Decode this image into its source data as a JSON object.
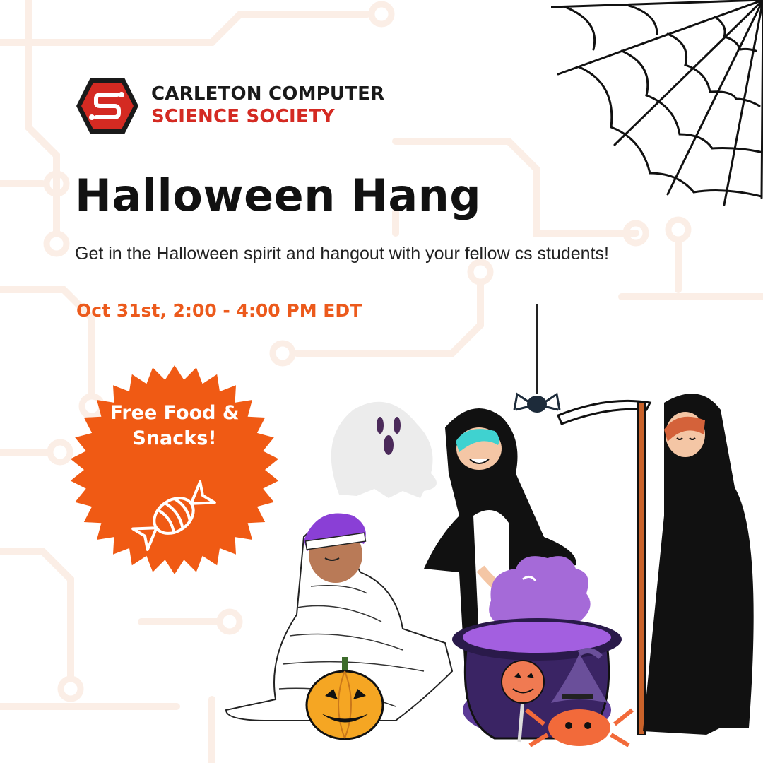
{
  "logo": {
    "line1": "CARLETON COMPUTER",
    "line2": "SCIENCE SOCIETY",
    "icon": "hexagon-circuit-s-logo"
  },
  "event": {
    "title": "Halloween Hang",
    "description": "Get in the Halloween spirit and hangout with your fellow cs students!",
    "datetime": "Oct 31st,  2:00 - 4:00 PM EDT"
  },
  "badge": {
    "line1": "Free Food &",
    "line2": "Snacks!",
    "icon": "candy-icon"
  },
  "colors": {
    "accent": "#ec5a1c",
    "badge": "#f05a14",
    "brand_red": "#d42a22",
    "text": "#111111"
  },
  "illustrations": [
    "spider-web",
    "spider",
    "ghost",
    "mummy-character",
    "penguin-costume-character",
    "grim-reaper-character",
    "cauldron",
    "jack-o-lantern",
    "lollipop",
    "crab-with-witch-hat"
  ]
}
